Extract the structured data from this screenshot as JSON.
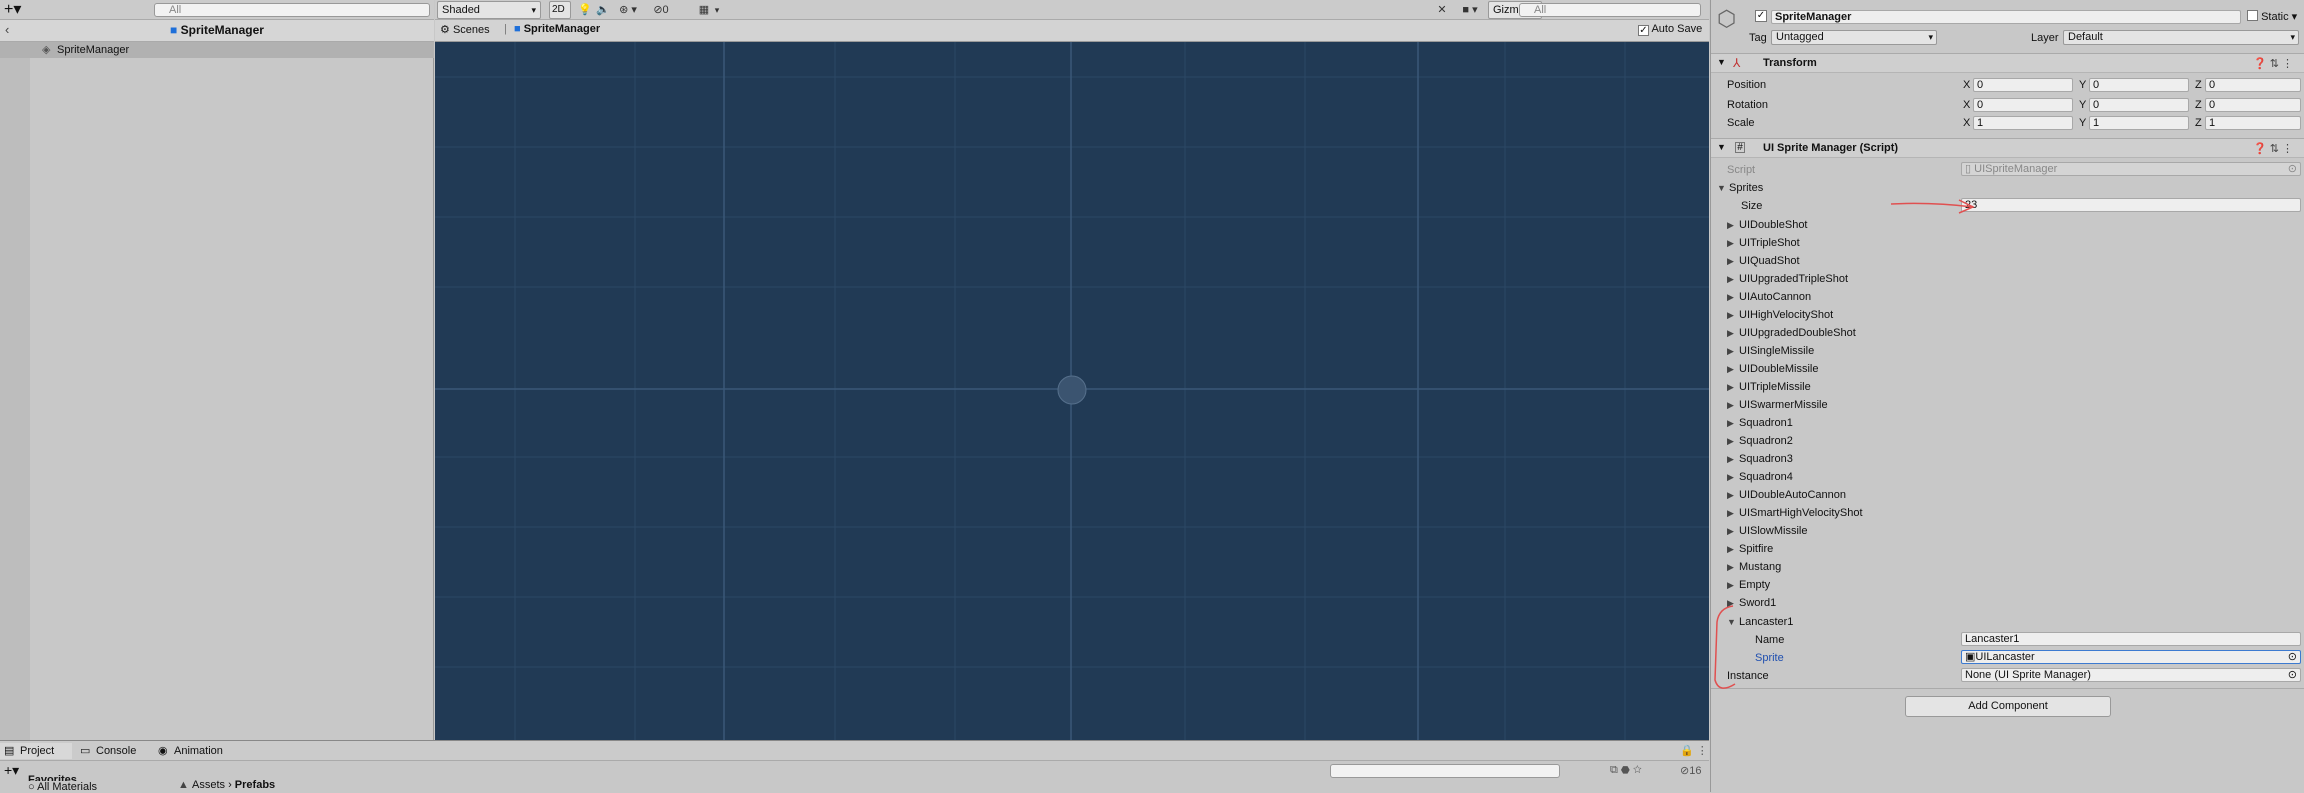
{
  "hierarchy": {
    "search_placeholder": "All",
    "scene_title": "SpriteManager",
    "items": [
      "SpriteManager"
    ]
  },
  "scene_view": {
    "shading_mode": "Shaded",
    "mode_2d": "2D",
    "hidden_count": "0",
    "gizmos_label": "Gizmos",
    "search_placeholder": "All",
    "breadcrumb_scenes": "Scenes",
    "breadcrumb_current": "SpriteManager",
    "auto_save_label": "Auto Save",
    "auto_save_checked": true,
    "background_color": "#213a55"
  },
  "inspector": {
    "object_name": "SpriteManager",
    "active": true,
    "static_label": "Static",
    "tag_label": "Tag",
    "tag_value": "Untagged",
    "layer_label": "Layer",
    "layer_value": "Default",
    "transform": {
      "title": "Transform",
      "rows": [
        {
          "label": "Position",
          "x": "0",
          "y": "0",
          "z": "0"
        },
        {
          "label": "Rotation",
          "x": "0",
          "y": "0",
          "z": "0"
        },
        {
          "label": "Scale",
          "x": "1",
          "y": "1",
          "z": "1"
        }
      ],
      "x_label": "X",
      "y_label": "Y",
      "z_label": "Z"
    },
    "script_component": {
      "title": "UI Sprite Manager (Script)",
      "script_label": "Script",
      "script_value": "UISpriteManager",
      "sprites_label": "Sprites",
      "size_label": "Size",
      "size_value": "23",
      "elements": [
        "UIDoubleShot",
        "UITripleShot",
        "UIQuadShot",
        "UIUpgradedTripleShot",
        "UIAutoCannon",
        "UIHighVelocityShot",
        "UIUpgradedDoubleShot",
        "UISingleMissile",
        "UIDoubleMissile",
        "UITripleMissile",
        "UISwarmerMissile",
        "Squadron1",
        "Squadron2",
        "Squadron3",
        "Squadron4",
        "UIDoubleAutoCannon",
        "UISmartHighVelocityShot",
        "UISlowMissile",
        "Spitfire",
        "Mustang",
        "Empty",
        "Sword1"
      ],
      "expanded_element": "Lancaster1",
      "name_label": "Name",
      "name_value": "Lancaster1",
      "sprite_label": "Sprite",
      "sprite_value": "UILancaster",
      "instance_label": "Instance",
      "instance_value": "None (UI Sprite Manager)"
    },
    "add_component_label": "Add Component"
  },
  "bottom": {
    "tabs": [
      "Project",
      "Console",
      "Animation"
    ],
    "favorites_label": "Favorites",
    "all_materials_label": "All Materials",
    "breadcrumb": [
      "Assets",
      "Prefabs"
    ],
    "hidden_count": "16"
  },
  "annotation_color": "#e05050"
}
